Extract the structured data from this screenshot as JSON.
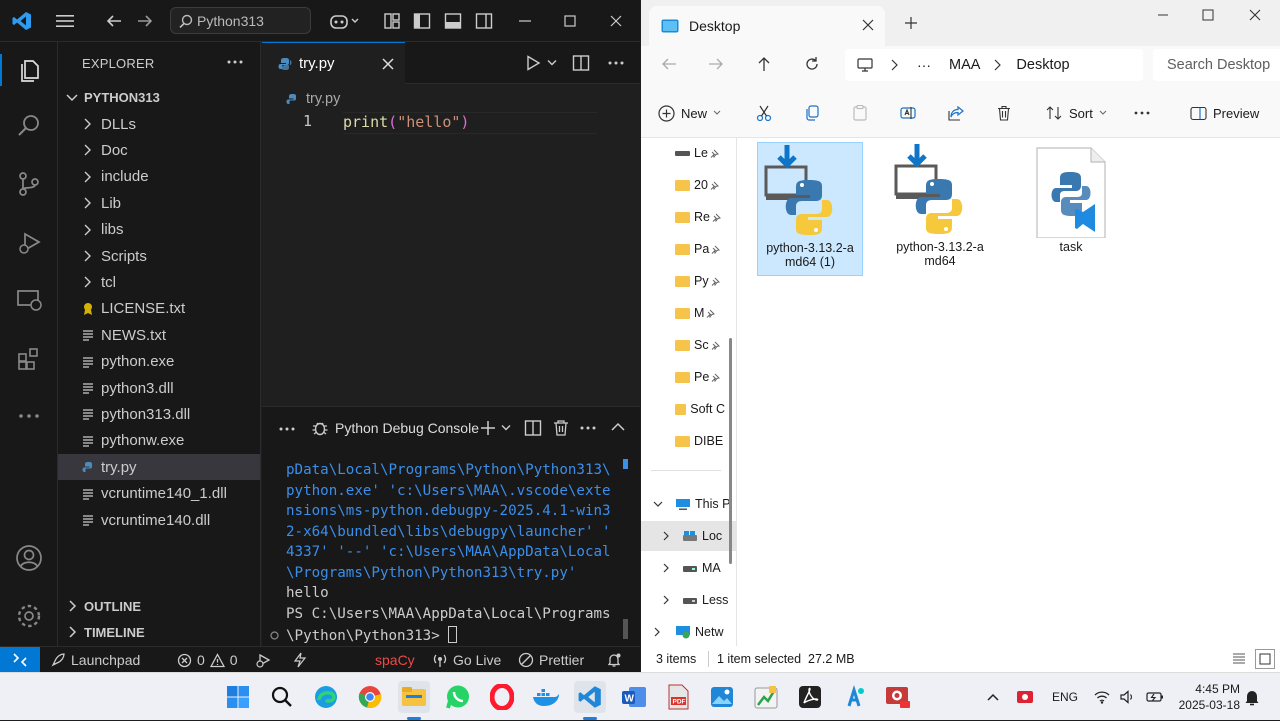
{
  "vscode": {
    "search": "Python313",
    "explorer_title": "EXPLORER",
    "root_folder": "PYTHON313",
    "tree": [
      {
        "label": "DLLs",
        "type": "folder"
      },
      {
        "label": "Doc",
        "type": "folder"
      },
      {
        "label": "include",
        "type": "folder"
      },
      {
        "label": "Lib",
        "type": "folder"
      },
      {
        "label": "libs",
        "type": "folder"
      },
      {
        "label": "Scripts",
        "type": "folder"
      },
      {
        "label": "tcl",
        "type": "folder"
      },
      {
        "label": "LICENSE.txt",
        "type": "license"
      },
      {
        "label": "NEWS.txt",
        "type": "text"
      },
      {
        "label": "python.exe",
        "type": "text"
      },
      {
        "label": "python3.dll",
        "type": "text"
      },
      {
        "label": "python313.dll",
        "type": "text"
      },
      {
        "label": "pythonw.exe",
        "type": "text"
      },
      {
        "label": "try.py",
        "type": "python"
      },
      {
        "label": "vcruntime140_1.dll",
        "type": "text"
      },
      {
        "label": "vcruntime140.dll",
        "type": "text"
      }
    ],
    "outline": "OUTLINE",
    "timeline": "TIMELINE",
    "tab_label": "try.py",
    "breadcrumb": "try.py",
    "line_number": "1",
    "code": {
      "fn": "print",
      "open": "(",
      "str": "\"hello\"",
      "close": ")"
    },
    "panel_title": "Python Debug Console",
    "terminal": {
      "lines": [
        "pData\\Local\\Programs\\Python\\Python313\\",
        "python.exe' 'c:\\Users\\MAA\\.vscode\\exte",
        "nsions\\ms-python.debugpy-2025.4.1-win3",
        "2-x64\\bundled\\libs\\debugpy\\launcher' '",
        "4337' '--' 'c:\\Users\\MAA\\AppData\\Local",
        "\\Programs\\Python\\Python313\\try.py'"
      ],
      "output": "hello",
      "prompt1": "PS C:\\Users\\MAA\\AppData\\Local\\Programs",
      "prompt2": "\\Python\\Python313> "
    },
    "status": {
      "launchpad": "Launchpad",
      "errors": "0",
      "warnings": "0",
      "spacy": "spaCy",
      "golive": "Go Live",
      "prettier": "Prettier"
    }
  },
  "explorer": {
    "tab_title": "Desktop",
    "breadcrumb": [
      "MAA",
      "Desktop"
    ],
    "search_placeholder": "Search Desktop",
    "cmd": {
      "new": "New",
      "sort": "Sort",
      "preview": "Preview"
    },
    "nav_items": [
      "Le",
      "20",
      "Re",
      "Pa",
      "Py",
      "M",
      "Sc",
      "Pe",
      "Soft C",
      "DIBE"
    ],
    "tree": {
      "this_pc": "This P",
      "local": "Loc",
      "maa": "MA",
      "less": "Less",
      "network": "Netw"
    },
    "files": [
      {
        "name": "python-3.13.2-amd64 (1)",
        "line1": "python-3.13.2-a",
        "line2": "md64 (1)",
        "selected": true
      },
      {
        "name": "python-3.13.2-amd64",
        "line1": "python-3.13.2-a",
        "line2": "md64",
        "selected": false
      },
      {
        "name": "task",
        "line1": "task",
        "line2": "",
        "selected": false
      }
    ],
    "status": {
      "count": "3 items",
      "selection": "1 item selected  27.2 MB"
    }
  },
  "taskbar": {
    "lang": "ENG",
    "time": "4:45 PM",
    "date": "2025-03-18"
  },
  "colors": {
    "vscode_accent": "#0078d4",
    "string": "#ce9178",
    "function": "#dcdcaa",
    "terminal_text": "#3b8eea"
  }
}
